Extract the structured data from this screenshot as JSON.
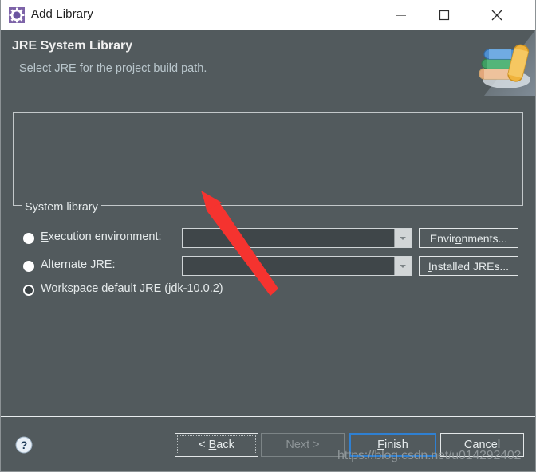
{
  "window": {
    "title": "Add Library",
    "icon": "eclipse-gear-icon",
    "controls": {
      "minimize": "minimize-icon",
      "maximize": "maximize-icon",
      "close": "close-icon"
    }
  },
  "header": {
    "title": "JRE System Library",
    "subtitle": "Select JRE for the project build path.",
    "image": "books-stack-icon"
  },
  "group": {
    "legend": "System library",
    "options": [
      {
        "id": "execution-environment",
        "label_pre": "E",
        "label_accel": "x",
        "label_post": "ecution environment:",
        "label_full": "Execution environment:",
        "selected": false,
        "combo_value": "",
        "combo_placeholder": "",
        "button_pre": "Envir",
        "button_accel": "o",
        "button_post": "nments...",
        "button_full": "Environments..."
      },
      {
        "id": "alternate-jre",
        "label_pre": "Alternate ",
        "label_accel": "J",
        "label_post": "RE:",
        "label_full": "Alternate JRE:",
        "selected": false,
        "combo_value": "",
        "combo_placeholder": "",
        "button_pre": "",
        "button_accel": "I",
        "button_post": "nstalled JREs...",
        "button_full": "Installed JREs..."
      },
      {
        "id": "workspace-default-jre",
        "label_pre": "Workspace ",
        "label_accel": "d",
        "label_post": "efault JRE (jdk-10.0.2)",
        "label_full": "Workspace default JRE (jdk-10.0.2)",
        "selected": true
      }
    ]
  },
  "footer": {
    "help": "?",
    "buttons": [
      {
        "id": "back",
        "pre": "< ",
        "accel": "B",
        "post": "ack",
        "full": "< Back",
        "state": "focused"
      },
      {
        "id": "next",
        "pre": "",
        "accel": "N",
        "post": "ext >",
        "full": "Next >",
        "state": "disabled"
      },
      {
        "id": "finish",
        "pre": "",
        "accel": "F",
        "post": "inish",
        "full": "Finish",
        "state": "default"
      },
      {
        "id": "cancel",
        "pre": "",
        "accel": "",
        "post": "Cancel",
        "full": "Cancel",
        "state": "normal"
      }
    ]
  },
  "watermark": "https://blog.csdn.net/u014292402",
  "colors": {
    "dialog_bg": "#525a5d",
    "titlebar_bg": "#ffffff",
    "text": "#e6ebec",
    "subtitle": "#b9c6cc",
    "accent_focus": "#2f80d2",
    "annotation_red": "#f5332f",
    "disabled_text": "#8d9497"
  }
}
